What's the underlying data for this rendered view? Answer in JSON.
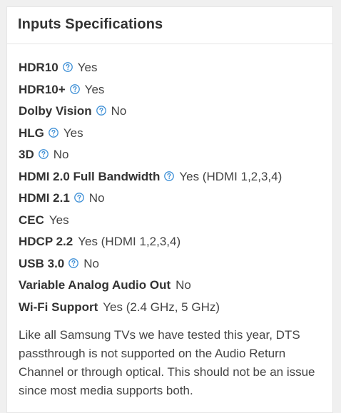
{
  "card": {
    "title": "Inputs Specifications",
    "specs": [
      {
        "label": "HDR10",
        "value": "Yes",
        "help": true
      },
      {
        "label": "HDR10+",
        "value": "Yes",
        "help": true
      },
      {
        "label": "Dolby Vision",
        "value": "No",
        "help": true
      },
      {
        "label": "HLG",
        "value": "Yes",
        "help": true
      },
      {
        "label": "3D",
        "value": "No",
        "help": true
      },
      {
        "label": "HDMI 2.0 Full Bandwidth",
        "value": "Yes (HDMI 1,2,3,4)",
        "help": true
      },
      {
        "label": "HDMI 2.1",
        "value": "No",
        "help": true
      },
      {
        "label": "CEC",
        "value": "Yes",
        "help": false
      },
      {
        "label": "HDCP 2.2",
        "value": "Yes (HDMI 1,2,3,4)",
        "help": false
      },
      {
        "label": "USB 3.0",
        "value": "No",
        "help": true
      },
      {
        "label": "Variable Analog Audio Out",
        "value": "No",
        "help": false
      },
      {
        "label": "Wi-Fi Support",
        "value": "Yes (2.4 GHz, 5 GHz)",
        "help": false
      }
    ],
    "note": "Like all Samsung TVs we have tested this year, DTS passthrough is not supported on the Audio Return Channel or through optical. This should not be an issue since most media supports both."
  },
  "colors": {
    "help_icon": "#3d8fd6",
    "title": "#333333",
    "text": "#444444",
    "border": "#e6e6e6",
    "page_bg": "#f0f0f0"
  },
  "icons": {
    "help": "help-circle-icon"
  }
}
